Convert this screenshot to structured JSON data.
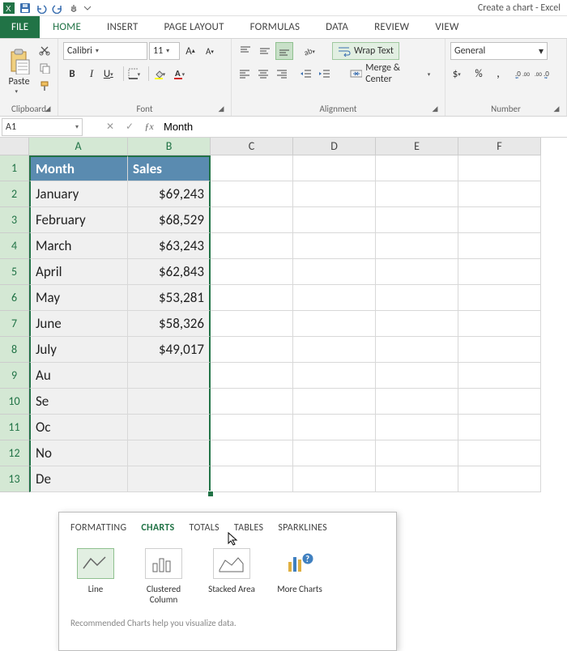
{
  "window": {
    "title": "Create a chart - Excel"
  },
  "qat": {
    "save": "save-icon",
    "undo": "undo-icon",
    "redo": "redo-icon",
    "touch": "touch-icon"
  },
  "tabs": {
    "file": "FILE",
    "items": [
      "HOME",
      "INSERT",
      "PAGE LAYOUT",
      "FORMULAS",
      "DATA",
      "REVIEW",
      "VIEW"
    ],
    "active": "HOME"
  },
  "ribbon": {
    "clipboard": {
      "label": "Clipboard",
      "paste": "Paste"
    },
    "font": {
      "label": "Font",
      "name": "Calibri",
      "size": "11",
      "bold": "B",
      "italic": "I",
      "underline": "U"
    },
    "alignment": {
      "label": "Alignment",
      "wrap": "Wrap Text",
      "merge": "Merge & Center"
    },
    "number": {
      "label": "Number",
      "format": "General"
    }
  },
  "namebox": "A1",
  "formula": "Month",
  "columns": [
    "A",
    "B",
    "C",
    "D",
    "E",
    "F"
  ],
  "rows": [
    "1",
    "2",
    "3",
    "4",
    "5",
    "6",
    "7",
    "8",
    "9",
    "10",
    "11",
    "12",
    "13"
  ],
  "chart_data": {
    "type": "table",
    "headers": [
      "Month",
      "Sales"
    ],
    "rows": [
      [
        "January",
        "$69,243"
      ],
      [
        "February",
        "$68,529"
      ],
      [
        "March",
        "$63,243"
      ],
      [
        "April",
        "$62,843"
      ],
      [
        "May",
        "$53,281"
      ],
      [
        "June",
        "$58,326"
      ],
      [
        "July",
        "$49,017"
      ],
      [
        "Au",
        ""
      ],
      [
        "Se",
        ""
      ],
      [
        "Oc",
        ""
      ],
      [
        "No",
        ""
      ],
      [
        "De",
        ""
      ]
    ]
  },
  "quick_analysis": {
    "tabs": [
      "FORMATTING",
      "CHARTS",
      "TOTALS",
      "TABLES",
      "SPARKLINES"
    ],
    "active": "CHARTS",
    "items": [
      {
        "label": "Line"
      },
      {
        "label": "Clustered Column"
      },
      {
        "label": "Stacked Area"
      },
      {
        "label": "More Charts"
      }
    ],
    "hint": "Recommended Charts help you visualize data."
  }
}
